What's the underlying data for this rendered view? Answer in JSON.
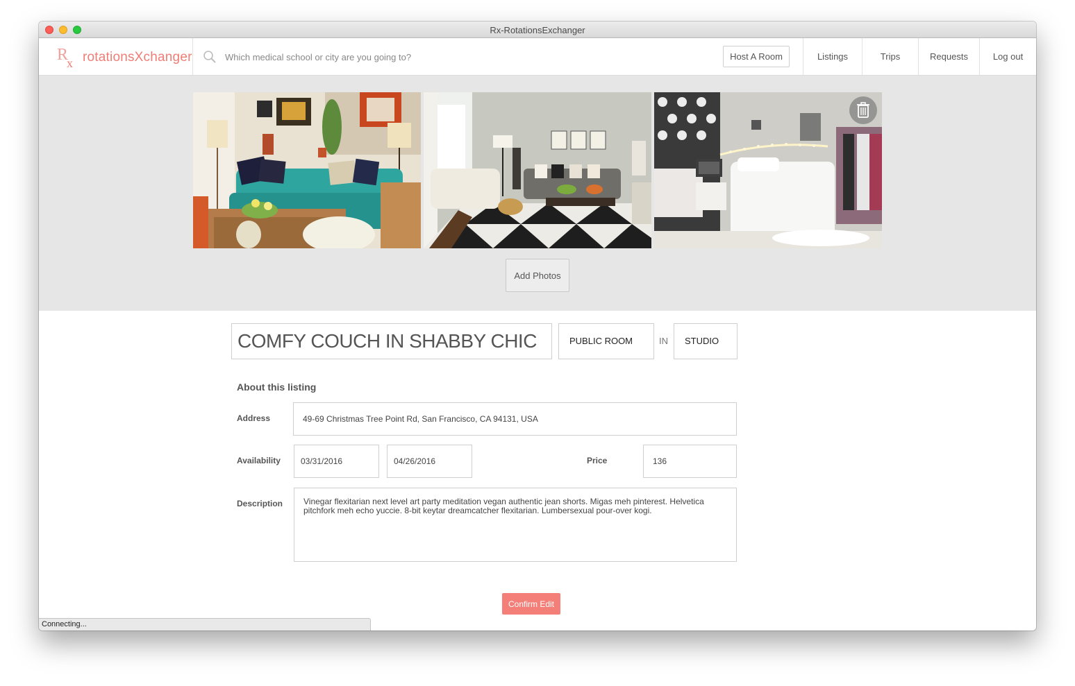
{
  "window": {
    "title": "Rx-RotationsExchanger"
  },
  "navbar": {
    "logo_text": "rotationsXchanger",
    "search_placeholder": "Which medical school or city are you going to?",
    "host_button": "Host A Room",
    "links": [
      "Listings",
      "Trips",
      "Requests",
      "Log out"
    ]
  },
  "gallery": {
    "photos": [
      "living-room-teal-sofa",
      "living-room-checkered-rug",
      "bedroom-string-lights"
    ],
    "add_photos_label": "Add Photos"
  },
  "listing": {
    "title": "COMFY COUCH IN SHABBY CHIC",
    "room_type": "PUBLIC ROOM",
    "in_label": "IN",
    "property_type": "STUDIO",
    "section_title": "About this listing",
    "address_label": "Address",
    "address": "49-69 Christmas Tree Point Rd, San Francisco, CA 94131, USA",
    "availability_label": "Availability",
    "start_date": "03/31/2016",
    "end_date": "04/26/2016",
    "price_label": "Price",
    "price": "136",
    "description_label": "Description",
    "description": "Vinegar flexitarian next level art party meditation vegan authentic jean shorts. Migas meh pinterest. Helvetica pitchfork meh echo yuccie. 8-bit keytar dreamcatcher flexitarian. Lumbersexual pour-over kogi."
  },
  "confirm_button": "Confirm Edit",
  "status_bar": "Connecting...",
  "colors": {
    "brand": "#f37f78",
    "gallery_bg": "#e6e6e6"
  }
}
